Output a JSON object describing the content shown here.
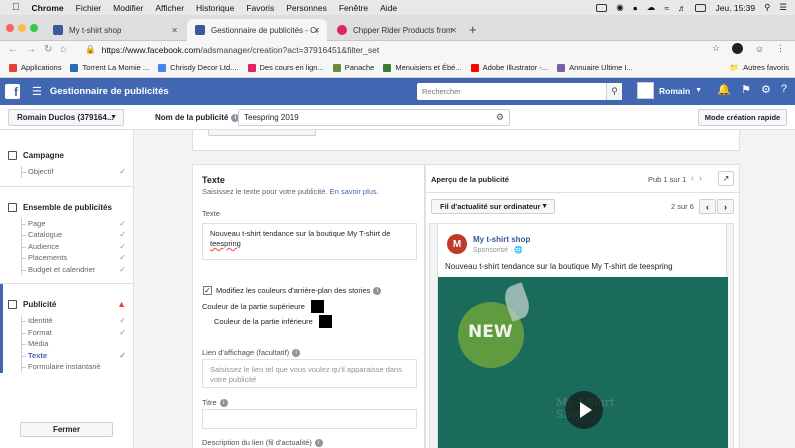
{
  "mac_menu": {
    "app": "Chrome",
    "items": [
      "Fichier",
      "Modifier",
      "Afficher",
      "Historique",
      "Favoris",
      "Personnes",
      "Fenêtre",
      "Aide"
    ],
    "clock": "Jeu. 15:39"
  },
  "tabs": [
    {
      "title": "My t-shirt shop",
      "color": "#3b5998"
    },
    {
      "title": "Gestionnaire de publicités - Cré",
      "color": "#3b5998"
    },
    {
      "title": "Chpper Rider Products from R",
      "color": "#e0245e"
    }
  ],
  "omnibox": {
    "host": "https://www.facebook.com",
    "path": "/adsmanager/creation?act=37916451&filter_set"
  },
  "bookmarks": [
    {
      "label": "Applications",
      "color": "#e34133"
    },
    {
      "label": "Torrent La Momie ...",
      "color": "#2b6cb0"
    },
    {
      "label": "Chrisdy Decor Ltd....",
      "color": "#4285f4"
    },
    {
      "label": "Des cours en lign...",
      "color": "#e0245e"
    },
    {
      "label": "Panache",
      "color": "#6d8b3a"
    },
    {
      "label": "Menuisiers et Ébé...",
      "color": "#3a7d2b"
    },
    {
      "label": "Adobe Illustrator -...",
      "color": "#ff0000"
    },
    {
      "label": "Annuaire Ultime I...",
      "color": "#7b5ea7"
    }
  ],
  "bookmarks_other": "Autres favoris",
  "fb": {
    "title": "Gestionnaire de publicités",
    "search_placeholder": "Rechercher",
    "user": "Romain"
  },
  "subbar": {
    "account": "Romain Duclos (379164...",
    "ad_name_label": "Nom de la publicité",
    "ad_name_value": "Teespring 2019",
    "quick_mode": "Mode création rapide"
  },
  "sidebar": {
    "campaign": "Campagne",
    "campaign_items": [
      "Objectif"
    ],
    "adset": "Ensemble de publicités",
    "adset_items": [
      "Page",
      "Catalogue",
      "Audience",
      "Placements",
      "Budget et calendrier"
    ],
    "ad": "Publicité",
    "ad_items": [
      "Identité",
      "Format",
      "Média",
      "Texte",
      "Formulaire instantané"
    ],
    "close": "Fermer"
  },
  "editor": {
    "title": "Texte",
    "subtitle": "Saisissez le texte pour votre publicité.",
    "learn_more": "En savoir plus.",
    "text_label": "Texte",
    "text_line1": "Nouveau t-shirt tendance sur la boutique My T-shirt de",
    "text_line2": "teespring",
    "stories_check": "Modifiez les couleurs d'arrière-plan des stories",
    "top_color_label": "Couleur de la partie supérieure",
    "bottom_color_label": "Couleur de la partie inférieure",
    "top_color": "#000000",
    "bottom_color": "#000000",
    "display_link_label": "Lien d'affichage (facultatif)",
    "display_link_placeholder": "Saisissez le lien tel que vous voulez qu'il apparaisse dans votre publicité",
    "title_label": "Titre",
    "desc_label": "Description du lien (fil d'actualité)"
  },
  "preview": {
    "title": "Aperçu de la publicité",
    "pub_count": "Pub 1 sur 1",
    "placement": "Fil d'actualité sur ordinateur",
    "page_count": "2 sur 6",
    "page_name": "My t-shirt shop",
    "sponsored": "Sponsorisé",
    "post_text": "Nouveau t-shirt tendance sur la boutique My T-shirt de teespring",
    "badge_text": "NEW",
    "watermark_line1": "My T-Shirt",
    "watermark_line2": "Shop",
    "avatar_letter": "M"
  }
}
